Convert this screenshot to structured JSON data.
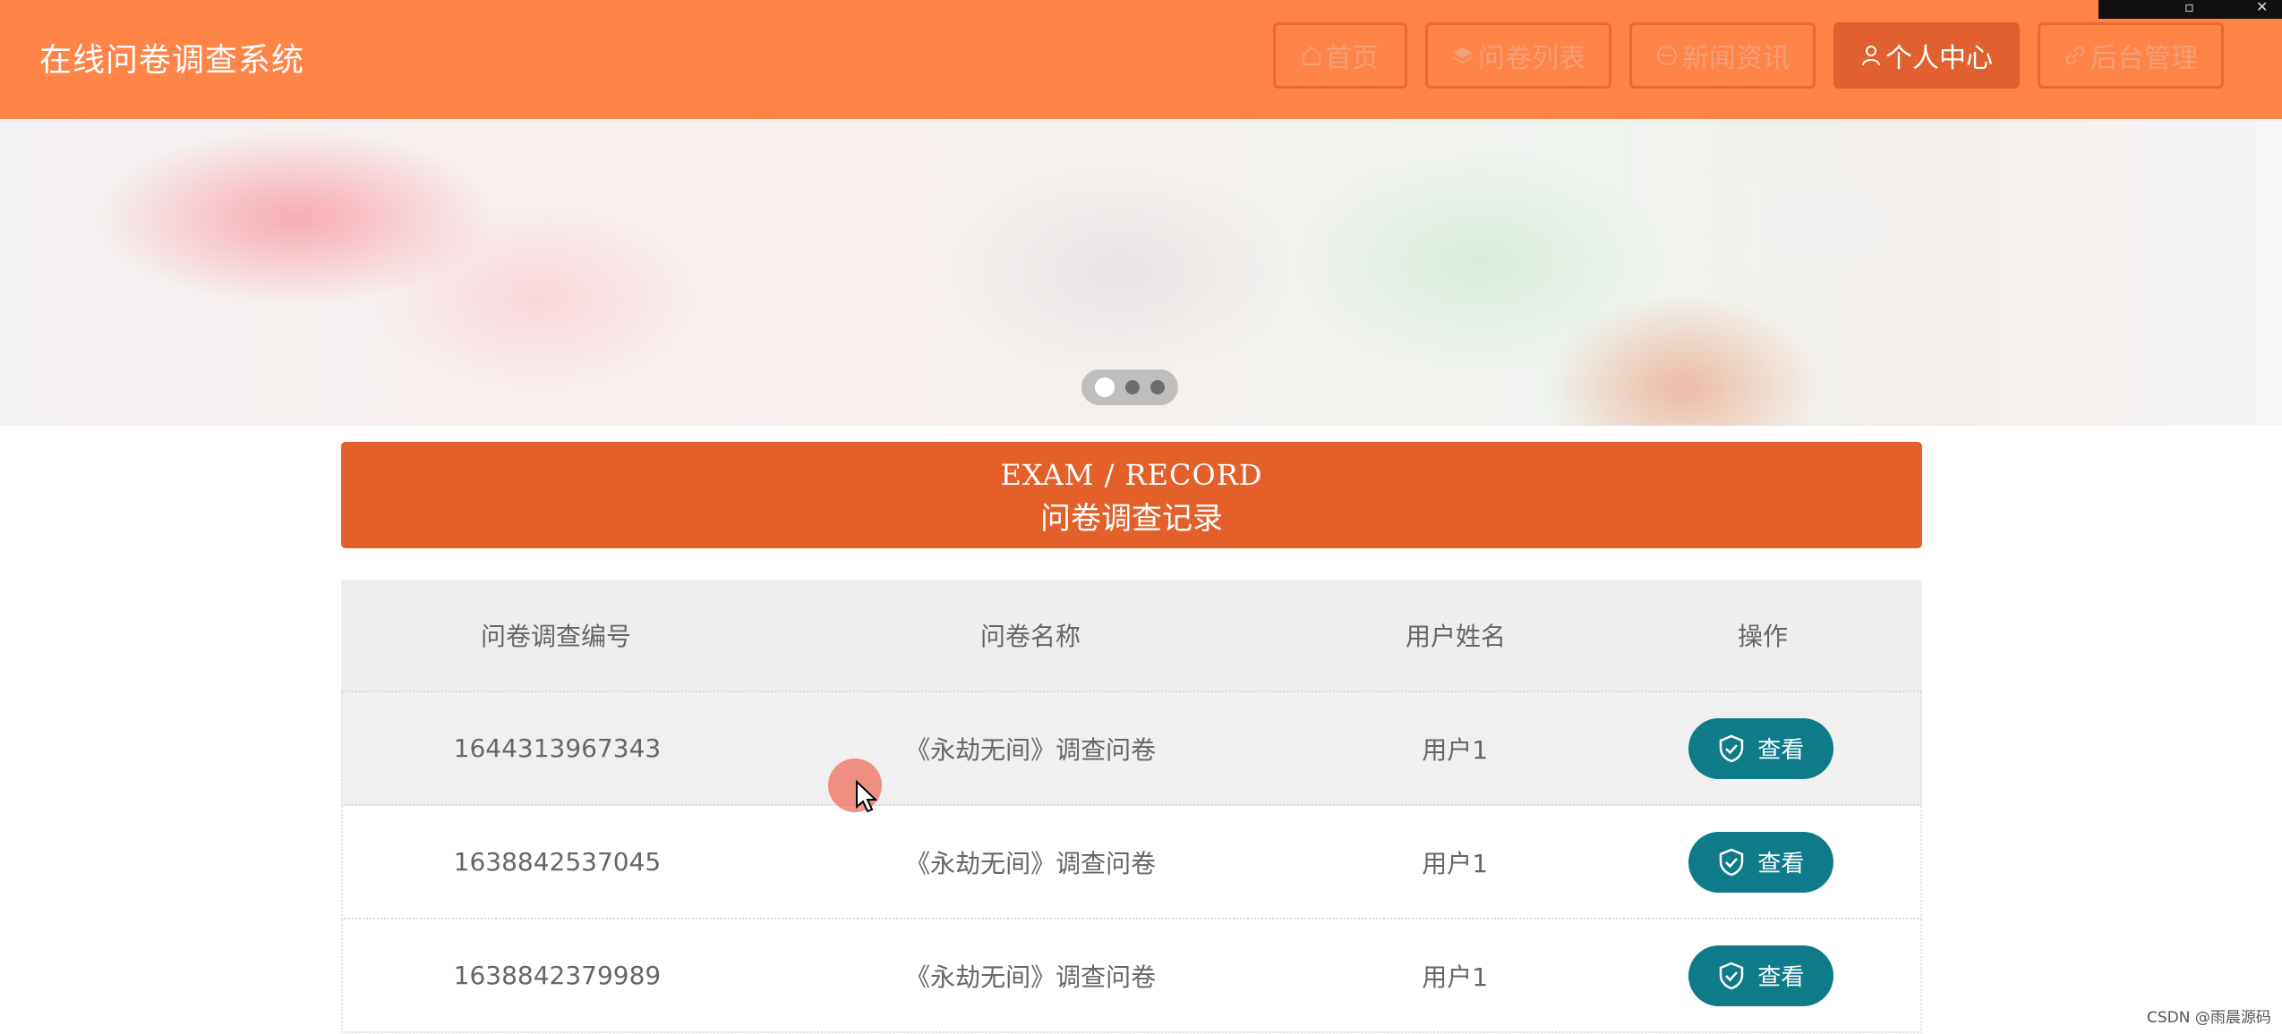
{
  "app": {
    "title": "在线问卷调查系统"
  },
  "nav": {
    "items": [
      {
        "label": "首页",
        "icon": "home-icon"
      },
      {
        "label": "问卷列表",
        "icon": "layers-icon"
      },
      {
        "label": "新闻资讯",
        "icon": "news-icon"
      },
      {
        "label": "个人中心",
        "icon": "user-icon",
        "active": true
      },
      {
        "label": "后台管理",
        "icon": "link-icon"
      }
    ]
  },
  "banner": {
    "slides": 3,
    "active_slide": 1
  },
  "record": {
    "title_en": "EXAM / RECORD",
    "title_cn": "问卷调查记录"
  },
  "table": {
    "columns": [
      "问卷调查编号",
      "问卷名称",
      "用户姓名",
      "操作"
    ],
    "rows": [
      {
        "id": "1644313967343",
        "name": "《永劫无间》调查问卷",
        "user": "用户1",
        "action": "查看"
      },
      {
        "id": "1638842537045",
        "name": "《永劫无间》调查问卷",
        "user": "用户1",
        "action": "查看"
      },
      {
        "id": "1638842379989",
        "name": "《永劫无间》调查问卷",
        "user": "用户1",
        "action": "查看"
      }
    ]
  },
  "watermark": "CSDN @雨晨源码",
  "colors": {
    "topbar": "#fe8447",
    "nav_active": "#e0602f",
    "record_header": "#e3602b",
    "view_button": "#0f7a8a"
  }
}
